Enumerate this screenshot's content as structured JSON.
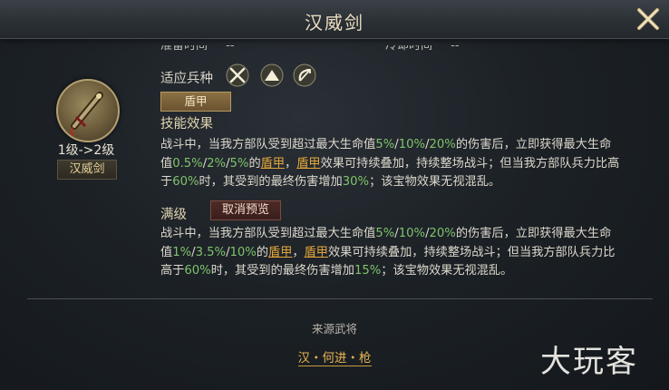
{
  "header": {
    "title": "汉威剑"
  },
  "top_row": {
    "prep_label": "准备时间",
    "prep_value": "--",
    "cooldown_label": "冷却时间",
    "cooldown_value": "--"
  },
  "troops": {
    "label": "适应兵种",
    "icons": [
      "crossed-swords-icon",
      "tent-icon",
      "bow-icon"
    ]
  },
  "treasure": {
    "level_text": "1级->2级",
    "name": "汉威剑"
  },
  "armor_tag": "盾甲",
  "skill": {
    "label": "技能效果",
    "p1": "战斗中，当我方部队受到超过最大生命值",
    "hp1": "5%",
    "s1": "/",
    "hp2": "10%",
    "s2": "/",
    "hp3": "20%",
    "p2": "的伤害后，立即获得最大生命值",
    "sh1": "0.5%",
    "s3": "/",
    "sh2": "2%",
    "s4": "/",
    "sh3": "5%",
    "p3": "的",
    "kw1": "盾甲",
    "p4": "，",
    "kw2": "盾甲",
    "p5": "效果可持续叠加，持续整场战斗；但当我方部队兵力比高于",
    "pct": "60%",
    "p6": "时，其受到的最终伤害增加",
    "dmg": "30%",
    "p7": "；该宝物效果无视混乱。"
  },
  "max_level": {
    "label": "满级",
    "cancel_button": "取消预览",
    "p1": "战斗中，当我方部队受到超过最大生命值",
    "hp1": "5%",
    "s1": "/",
    "hp2": "10%",
    "s2": "/",
    "hp3": "20%",
    "p2": "的伤害后，立即获得最大生命值",
    "sh1": "1%",
    "s3": "/",
    "sh2": "3.5%",
    "s4": "/",
    "sh3": "10%",
    "p3": "的",
    "kw1": "盾甲",
    "p4": "，",
    "kw2": "盾甲",
    "p5": "效果可持续叠加，持续整场战斗；但当我方部队兵力比高于",
    "pct": "60%",
    "p6": "时，其受到的最终伤害增加",
    "dmg": "15%",
    "p7": "；该宝物效果无视混乱。"
  },
  "source": {
    "label": "来源武将",
    "general": "汉・何进・枪"
  },
  "watermark": "大玩客",
  "colors": {
    "value_green": "#7fc36b",
    "keyword_orange": "#e2a53a",
    "title_gold": "#e9dcc0"
  }
}
